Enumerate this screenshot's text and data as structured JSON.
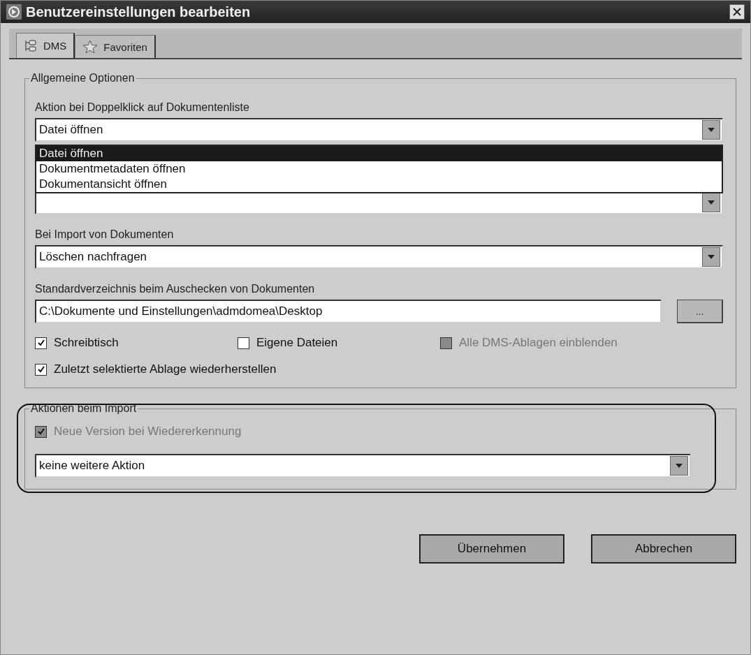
{
  "window": {
    "title": "Benutzereinstellungen bearbeiten"
  },
  "tabs": [
    {
      "label": "DMS",
      "selected": true
    },
    {
      "label": "Favoriten",
      "selected": false
    }
  ],
  "general_options": {
    "title": "Allgemeine Optionen",
    "double_click": {
      "label": "Aktion bei Doppelklick auf Dokumentenliste",
      "value": "Datei öffnen",
      "expanded": true,
      "options": [
        {
          "label": "Datei öffnen",
          "selected": true
        },
        {
          "label": "Dokumentmetadaten öffnen",
          "selected": false
        },
        {
          "label": "Dokumentansicht öffnen",
          "selected": false
        }
      ]
    },
    "import": {
      "label": "Bei Import von Dokumenten",
      "value": "Löschen nachfragen"
    },
    "checkout_dir": {
      "label": "Standardverzeichnis beim Auschecken von Dokumenten",
      "value": "C:\\Dokumente und Einstellungen\\admdomea\\Desktop",
      "browse": "..."
    },
    "checkbox_rows": [
      [
        {
          "label": "Schreibtisch",
          "checked": true,
          "disabled": false
        },
        {
          "label": "Eigene Dateien",
          "checked": false,
          "disabled": false
        },
        {
          "label": "Alle DMS-Ablagen einblenden",
          "checked": false,
          "disabled": true
        }
      ],
      [
        {
          "label": "Zuletzt selektierte Ablage wiederherstellen",
          "checked": true,
          "disabled": false
        }
      ]
    ]
  },
  "import_actions": {
    "title": "Aktionen beim Import",
    "highlighted": true,
    "checkbox": {
      "label": "Neue Version bei Wiedererkennung",
      "checked": true,
      "disabled": true
    },
    "action": {
      "value": "keine weitere Aktion"
    }
  },
  "buttons": [
    {
      "label": "Übernehmen"
    },
    {
      "label": "Abbrechen"
    }
  ]
}
